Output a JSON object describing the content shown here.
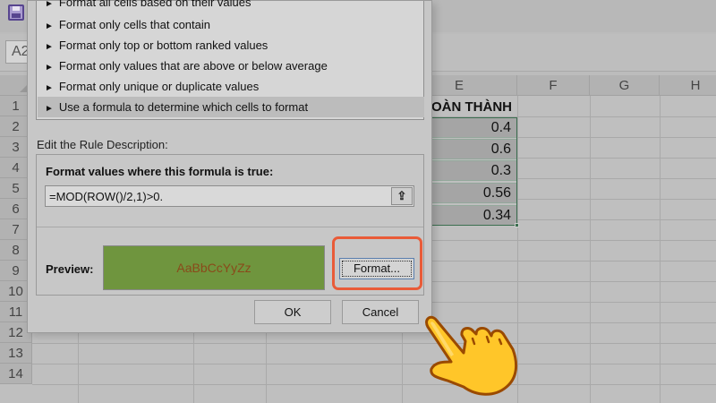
{
  "excel": {
    "name_box": "A2",
    "columns": [
      "E",
      "F",
      "G",
      "H"
    ],
    "rows": [
      "1",
      "2",
      "3",
      "4",
      "5",
      "6",
      "7",
      "8",
      "9",
      "10",
      "11",
      "12",
      "13",
      "14"
    ],
    "e1_header": "OÀN THÀNH",
    "e_values": [
      "0.4",
      "0.6",
      "0.3",
      "0.56",
      "0.34"
    ]
  },
  "dialog": {
    "rule_types": [
      "Format all cells based on their values",
      "Format only cells that contain",
      "Format only top or bottom ranked values",
      "Format only values that are above or below average",
      "Format only unique or duplicate values",
      "Use a formula to determine which cells to format"
    ],
    "selected_rule_index": 5,
    "edit_rule_label": "Edit the Rule Description:",
    "formula_label": "Format values where this formula is true:",
    "formula_value": "=MOD(ROW()/2,1)>0.",
    "preview_label": "Preview:",
    "preview_text": "AaBbCcYyZz",
    "format_button": "Format...",
    "ok_button": "OK",
    "cancel_button": "Cancel"
  },
  "colors": {
    "preview_fill": "#6f953e",
    "preview_text": "#8a4a1a",
    "highlight": "#e95b38",
    "selection": "#3b6e4f"
  },
  "icons": {
    "save": "save-icon",
    "collapse": "collapse-dialog-icon",
    "pointer": "hand-pointer-icon"
  }
}
